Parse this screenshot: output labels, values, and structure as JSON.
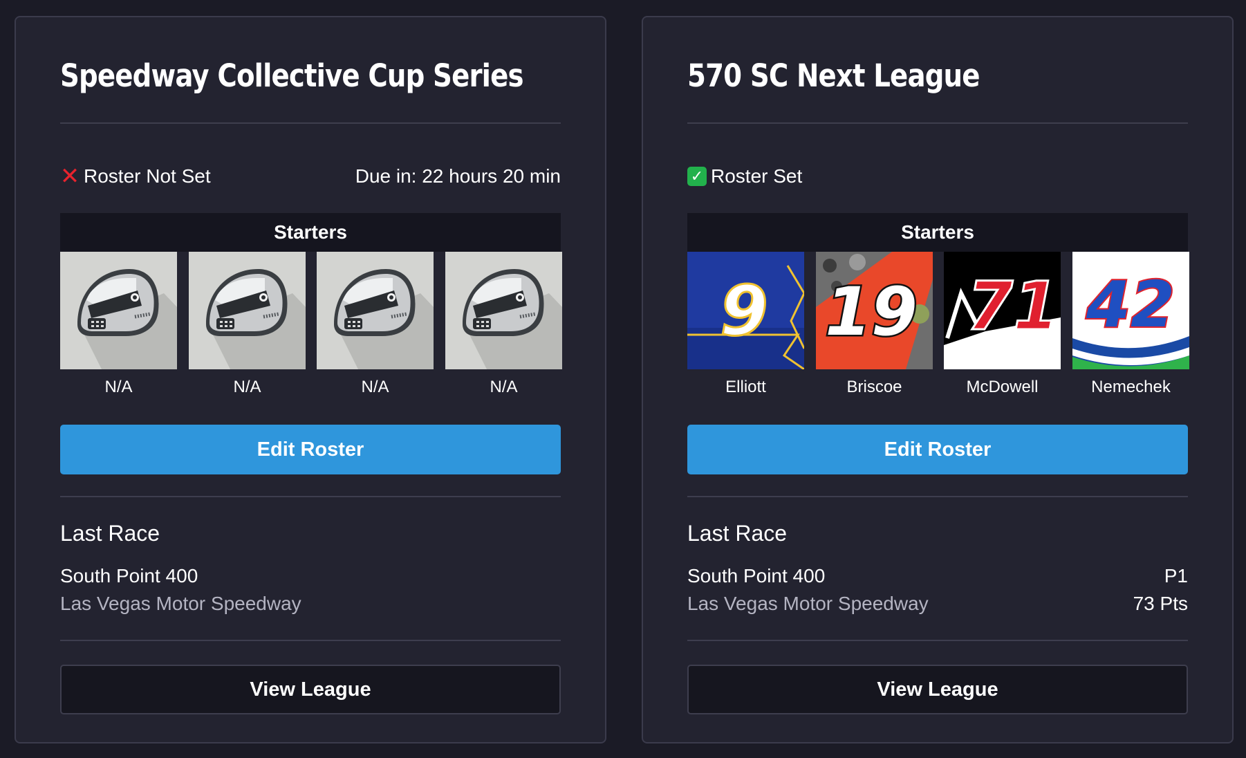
{
  "leagues": [
    {
      "title": "Speedway Collective Cup Series",
      "status_icon": "x-mark-icon",
      "status_color": "#e8232d",
      "status_label": "Roster Not Set",
      "due_text": "Due in: 22 hours 20 min",
      "starters_label": "Starters",
      "drivers": [
        {
          "name": "N/A",
          "image": "helmet-placeholder"
        },
        {
          "name": "N/A",
          "image": "helmet-placeholder"
        },
        {
          "name": "N/A",
          "image": "helmet-placeholder"
        },
        {
          "name": "N/A",
          "image": "helmet-placeholder"
        }
      ],
      "edit_label": "Edit Roster",
      "last_race_heading": "Last Race",
      "race_name": "South Point 400",
      "track": "Las Vegas Motor Speedway",
      "position": "",
      "points": "",
      "view_label": "View League"
    },
    {
      "title": "570 SC Next League",
      "status_icon": "check-mark-icon",
      "status_color": "#22b14c",
      "status_label": "Roster Set",
      "due_text": "",
      "starters_label": "Starters",
      "drivers": [
        {
          "name": "Elliott",
          "car_number": "9",
          "image": "car-number-9"
        },
        {
          "name": "Briscoe",
          "car_number": "19",
          "image": "car-number-19"
        },
        {
          "name": "McDowell",
          "car_number": "71",
          "image": "car-number-71"
        },
        {
          "name": "Nemechek",
          "car_number": "42",
          "image": "car-number-42"
        }
      ],
      "edit_label": "Edit Roster",
      "last_race_heading": "Last Race",
      "race_name": "South Point 400",
      "track": "Las Vegas Motor Speedway",
      "position": "P1",
      "points": "73 Pts",
      "view_label": "View League"
    }
  ],
  "colors": {
    "background": "#1b1b26",
    "card": "#232330",
    "accent_button": "#2f96dc",
    "muted_text": "#b4b4c2"
  }
}
